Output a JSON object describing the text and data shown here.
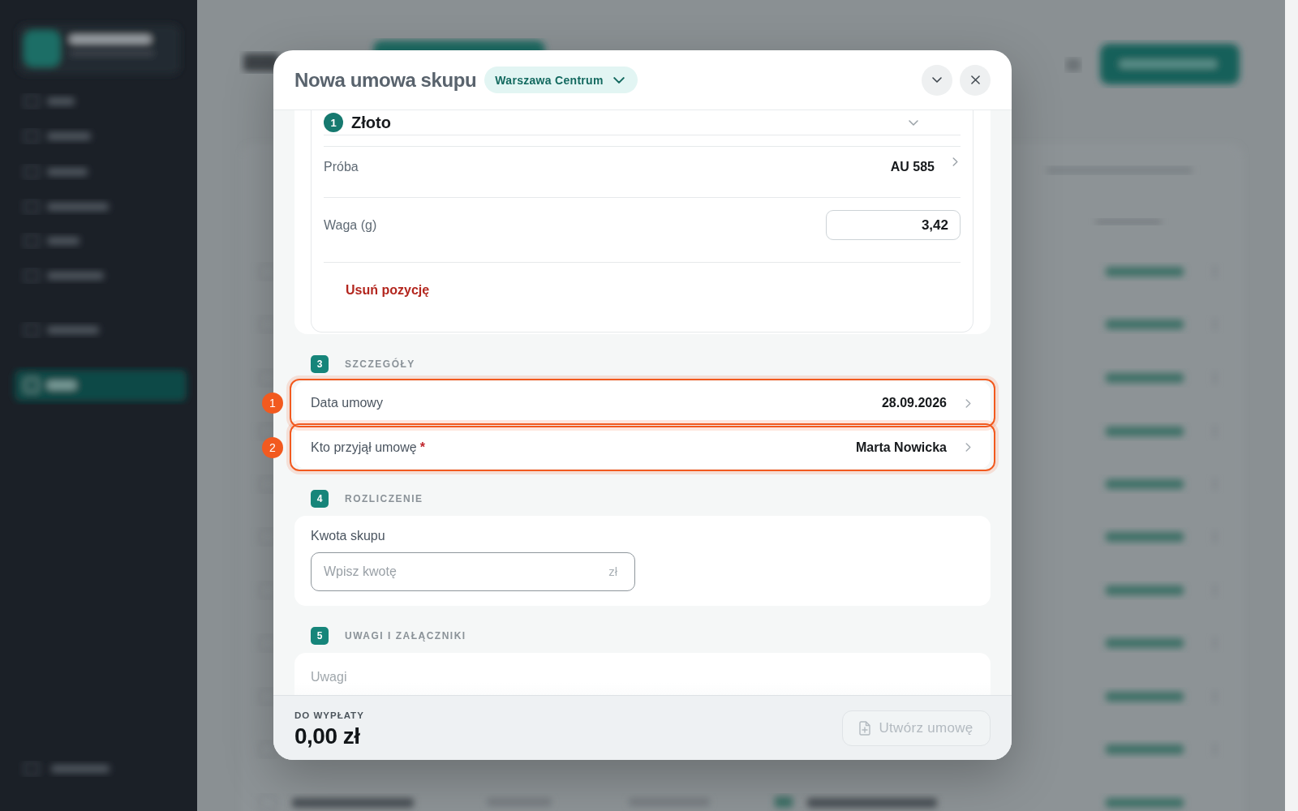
{
  "window": {
    "title": "Nowa umowa skupu",
    "branch": "Warszawa Centrum"
  },
  "item": {
    "number": "1",
    "name": "Złoto",
    "fields": [
      {
        "kind": "select",
        "label": "Próba",
        "value": "AU 585"
      },
      {
        "kind": "input",
        "label": "Waga (g)",
        "value": "3,42"
      }
    ],
    "remove_label": "Usuń pozycję"
  },
  "sections": [
    {
      "number": "3",
      "title": "SZCZEGÓŁY",
      "kind": "rows",
      "rows": [
        {
          "label": "Data umowy",
          "value": "28.09.2026",
          "callout": "1"
        },
        {
          "label": "Kto przyjął umowę",
          "required_mark": "*",
          "value": "Marta Nowicka",
          "callout": "2"
        }
      ]
    },
    {
      "number": "4",
      "title": "ROZLICZENIE",
      "kind": "amount",
      "label": "Kwota skupu",
      "placeholder": "Wpisz kwotę",
      "unit": "zł"
    },
    {
      "number": "5",
      "title": "UWAGI I ZAŁĄCZNIKI",
      "kind": "notes",
      "label": "Uwagi"
    }
  ],
  "footer": {
    "total_label": "DO WYPŁATY",
    "total": "0,00 zł",
    "submit": {
      "label": "Utwórz umowę",
      "disabled": true
    }
  }
}
